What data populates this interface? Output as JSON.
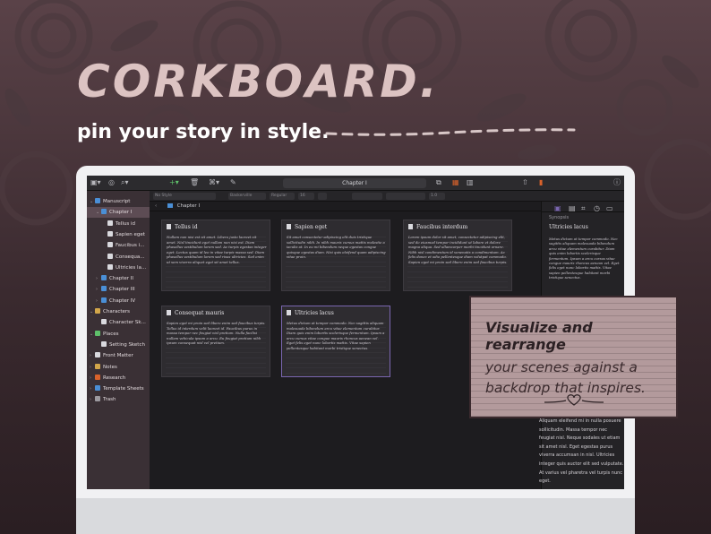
{
  "hero": {
    "title": "CORKBOARD.",
    "subtitle": "pin your story in style."
  },
  "colors": {
    "title_pink": "#dcc3c2",
    "accent_purple": "#7a66b0",
    "note_card_bg": "#b39a9c",
    "toolbar_orange": "#d9622b",
    "folder_blue": "#4a8fd6"
  },
  "toolbar": {
    "document_title": "Chapter I"
  },
  "formatbar": {
    "style": "No Style",
    "font": "Baskerville",
    "weight": "Regular",
    "size": "16",
    "line_spacing": "1.0"
  },
  "binder": {
    "items": [
      {
        "label": "Manuscript",
        "icon": "manuscript-icon",
        "level": 0
      },
      {
        "label": "Chapter I",
        "icon": "folder-icon",
        "level": 1,
        "selected": true
      },
      {
        "label": "Tellus id",
        "icon": "document-icon",
        "level": 2
      },
      {
        "label": "Sapien eget",
        "icon": "document-icon",
        "level": 2
      },
      {
        "label": "Faucibus i...",
        "icon": "document-icon",
        "level": 2
      },
      {
        "label": "Consequa...",
        "icon": "document-icon",
        "level": 2
      },
      {
        "label": "Ultricies la...",
        "icon": "document-icon",
        "level": 2
      },
      {
        "label": "Chapter II",
        "icon": "folder-icon",
        "level": 1
      },
      {
        "label": "Chapter III",
        "icon": "folder-icon",
        "level": 1
      },
      {
        "label": "Chapter IV",
        "icon": "folder-icon",
        "level": 1
      },
      {
        "label": "Characters",
        "icon": "characters-icon",
        "level": 0
      },
      {
        "label": "Character Sk...",
        "icon": "sketch-icon",
        "level": 1
      },
      {
        "label": "Places",
        "icon": "places-icon",
        "level": 0
      },
      {
        "label": "Setting Sketch",
        "icon": "sketch-icon",
        "level": 1
      },
      {
        "label": "Front Matter",
        "icon": "front-matter-icon",
        "level": 0
      },
      {
        "label": "Notes",
        "icon": "notes-icon",
        "level": 0
      },
      {
        "label": "Research",
        "icon": "research-icon",
        "level": 0
      },
      {
        "label": "Template Sheets",
        "icon": "template-icon",
        "level": 0
      },
      {
        "label": "Trash",
        "icon": "trash-icon",
        "level": 0
      }
    ]
  },
  "corkboard": {
    "header": "Chapter I",
    "cards": [
      {
        "title": "Tellus id",
        "body": "Nullam non nisi est sit amet. Libero justo laoreet sit amet. Nisl tincidunt eget nullam non nisi est. Diam phasellus vestibulum lorem sed. Ac turpis egestas integer eget. Lectus quam id leo in vitae turpis massa sed. Diam phasellus vestibulum lorem sed risus ultricies. Sed enim ut sem viverra aliquet eget sit amet tellus."
      },
      {
        "title": "Sapien eget",
        "body": "Sit amet consectetur adipiscing elit duis tristique sollicitudin nibh. In nibh mauris cursus mattis molestie a iaculis at. In eu mi bibendum neque egestas congue quisque egestas diam. Nisi quis eleifend quam adipiscing vitae proin."
      },
      {
        "title": "Faucibus interdum",
        "body": "Lorem ipsum dolor sit amet, consectetur adipiscing elit, sed do eiusmod tempor incididunt ut labore et dolore magna aliqua. Sed ullamcorper morbi tincidunt ornare. Nibh nisl condimentum id venenatis a condimentum. Ac felis donec et odio pellentesque diam volutpat commodo. Sapien eget mi proin sed libero enim sed faucibus turpis."
      },
      {
        "title": "Consequat mauris",
        "body": "Sapien eget mi proin sed libero enim sed faucibus turpis. Tellus id interdum velit laoreet id. Faucibus purus in massa tempor nec feugiat nisl pretium. Nulla facilisi nullam vehicula ipsum a arcu. Eu feugiat pretium nibh ipsum consequat nisl vel pretium."
      },
      {
        "title": "Ultricies lacus",
        "body": "Metus dictum at tempor commodo. Nec sagittis aliquam malesuada bibendum arcu vitae elementum curabitur. Diam quis enim lobortis scelerisque fermentum. Ipsum a arcu cursus vitae congue mauris rhoncus aenean vel. Eget felis eget nunc lobortis mattis. Vitae sapien pellentesque habitant morbi tristique senectus."
      }
    ]
  },
  "inspector": {
    "section_label": "Synopsis",
    "title": "Ultricies lacus",
    "synopsis": "Metus dictum at tempor commodo. Nec sagittis aliquam malesuada bibendum arcu vitae elementum curabitur. Diam quis enim lobortis scelerisque fermentum. Ipsum a arcu cursus vitae congue mauris rhoncus aenean vel. Eget felis eget nunc lobortis mattis. Vitae sapien pellentesque habitant morbi tristique senectus.",
    "notes": "Aliquam eleifend mi in nulla posuere sollicitudin. Massa tempor nec feugiat nisl. Neque sodales ut etiam sit amet nisl. Eget egestas purus viverra accumsan in nisl. Ultricies integer quis auctor elit sed vulputate. At varius vel pharetra vel turpis nunc eget."
  },
  "note_card": {
    "headline": "Visualize and rearrange",
    "line1": "your scenes against a",
    "line2": "backdrop that inspires."
  }
}
